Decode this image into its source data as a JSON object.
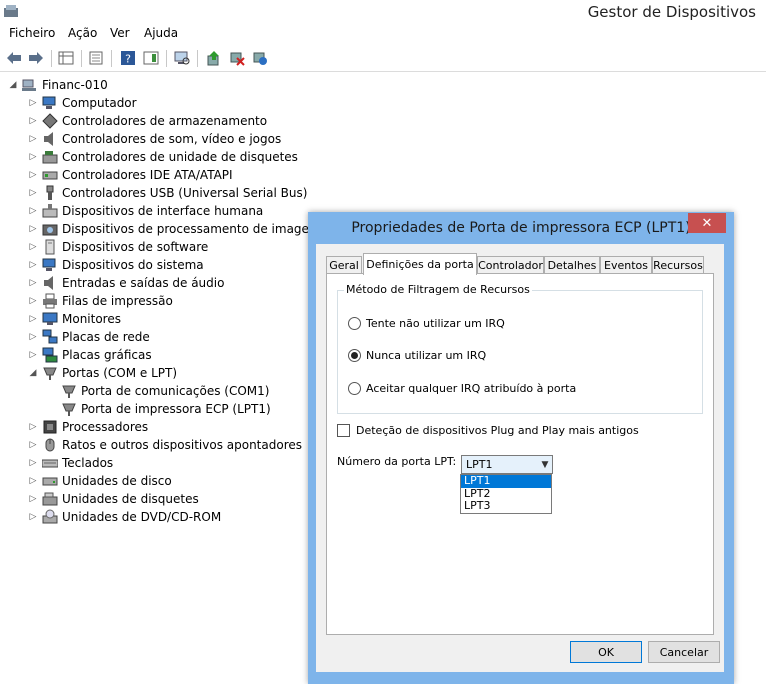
{
  "window": {
    "title": "Gestor de Dispositivos"
  },
  "menu": [
    "Ficheiro",
    "Ação",
    "Ver",
    "Ajuda"
  ],
  "toolbar_icons": [
    "back-arrow-icon",
    "forward-arrow-icon",
    "properties-grid-icon",
    "list-view-icon",
    "help-icon",
    "action-pane-icon",
    "monitor-scan-icon",
    "update-driver-icon",
    "disable-device-icon",
    "scan-hardware-icon"
  ],
  "tree": {
    "root": "Financ-010",
    "categories": [
      "Computador",
      "Controladores de armazenamento",
      "Controladores de som, vídeo e jogos",
      "Controladores de unidade de disquetes",
      "Controladores IDE ATA/ATAPI",
      "Controladores USB (Universal Serial Bus)",
      "Dispositivos de interface humana",
      "Dispositivos de processamento de imagens",
      "Dispositivos de software",
      "Dispositivos do sistema",
      "Entradas e saídas de áudio",
      "Filas de impressão",
      "Monitores",
      "Placas de rede",
      "Placas gráficas",
      "Portas (COM e LPT)",
      "Porta de comunicações (COM1)",
      "Porta de impressora ECP (LPT1)",
      "Processadores",
      "Ratos e outros dispositivos apontadores",
      "Teclados",
      "Unidades de disco",
      "Unidades de disquetes",
      "Unidades de DVD/CD-ROM"
    ]
  },
  "dialog": {
    "title": "Propriedades de Porta de impressora ECP (LPT1)",
    "close": "✕",
    "tabs": [
      "Geral",
      "Definições da porta",
      "Controlador",
      "Detalhes",
      "Eventos",
      "Recursos"
    ],
    "active_tab": 1,
    "group_label": "Método de Filtragem de Recursos",
    "radios": [
      "Tente não utilizar um IRQ",
      "Nunca utilizar um IRQ",
      "Aceitar qualquer IRQ atribuído à porta"
    ],
    "selected_radio": 1,
    "legacy_checkbox": "Deteção de dispositivos Plug and Play mais antigos",
    "legacy_checked": false,
    "port_label": "Número da porta LPT:",
    "port_value": "LPT1",
    "port_options": [
      "LPT1",
      "LPT2",
      "LPT3"
    ],
    "ok": "OK",
    "cancel": "Cancelar"
  },
  "colors": {
    "dialog_frame": "#7eb4ea",
    "close_button": "#c75050",
    "selection": "#0078d7"
  }
}
